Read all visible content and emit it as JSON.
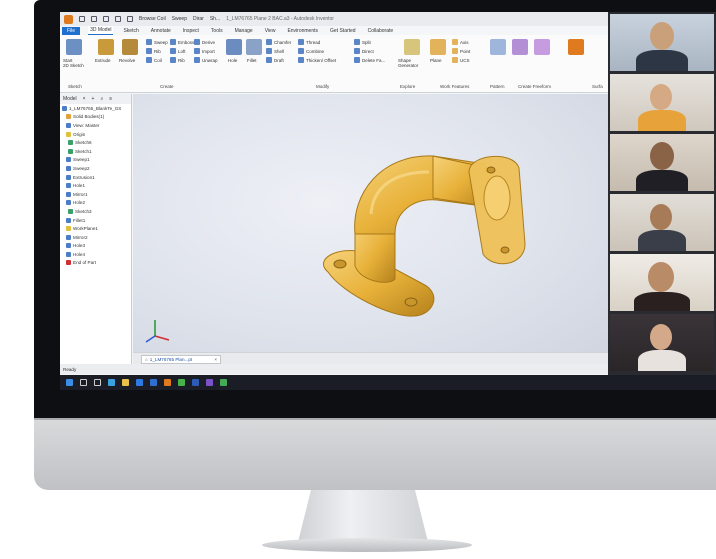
{
  "window": {
    "title_short": "Browse Coil",
    "title_full": "1_LM76765 Plane 2 BAC.a3 - Autodesk Inventor",
    "quick_access_1": "Sweep",
    "quick_access_2": "Dirar",
    "quick_access_3": "Sh..."
  },
  "ribbon_tabs": [
    "File",
    "3D Model",
    "Sketch",
    "Annotate",
    "Inspect",
    "Tools",
    "Manage",
    "View",
    "Environments",
    "Get Started",
    "Collaborate"
  ],
  "ribbon": {
    "start_sketch": "Start\n2D Sketch",
    "extrude": "Extrude",
    "revolve": "Revolve",
    "sweep": "Sweep",
    "emboss": "Emboss",
    "rib": "Rib",
    "loft": "Loft",
    "derive": "Derive",
    "import": "Import",
    "coil": "Coil",
    "decal": "Decal",
    "unwrap": "Unwrap",
    "hole": "Hole",
    "fillet": "Fillet",
    "chamfer": "Chamfer",
    "thread": "Thread",
    "shell": "Shell",
    "combine": "Combine",
    "draft": "Draft",
    "thicken_offset": "Thicken/ Offset",
    "split": "Split",
    "direct": "Direct",
    "delete_face": "Delete Fa...",
    "shape_generator": "Shape\nGenerator",
    "plane": "Plane",
    "axis": "Axis",
    "point": "Point",
    "ucs": "UCS",
    "sketch_group": "Sketch",
    "create_group": "Create",
    "modify_group": "Modify",
    "explore_group": "Explore",
    "work_features_group": "Work Features",
    "pattern_group": "Pattern",
    "create_freeform_group": "Create Freeform",
    "surface_group": "Surfa"
  },
  "browser": {
    "header": "Model",
    "tree": [
      "1_LM76765_BlankTe_GS",
      "Solid Bodies(1)",
      "View: Master",
      "Origin",
      "Sketch6",
      "Sketch1",
      "Sweep1",
      "Sweep2",
      "Extrusion1",
      "Hole1",
      "Mirror1",
      "Hole2",
      "Sketch3",
      "Fillet1",
      "WorkPlane1",
      "Mirror2",
      "Hole3",
      "Hole4",
      "End of Part"
    ]
  },
  "document_tab": "1_LM76765 Plan...pt",
  "status_text": "Ready",
  "colors": {
    "part": "#e8b23a",
    "part_dark": "#b5821c",
    "part_light": "#f6d27a",
    "accent": "#1e6fd0",
    "taskbar": "#1b1d26"
  },
  "icons": [
    "start-icon",
    "search-icon",
    "task-view-icon",
    "edge-icon",
    "explorer-icon",
    "store-icon",
    "mail-icon",
    "inventor-icon",
    "chrome-icon",
    "word-icon"
  ]
}
